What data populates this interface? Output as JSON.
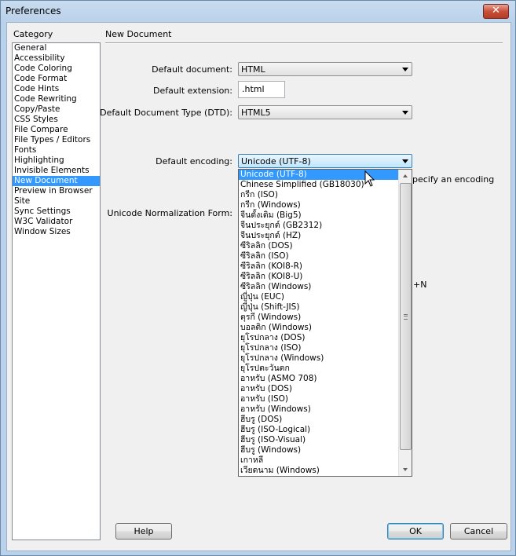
{
  "window": {
    "title": "Preferences",
    "close_glyph": "✕"
  },
  "category": {
    "label": "Category",
    "items": [
      "General",
      "Accessibility",
      "Code Coloring",
      "Code Format",
      "Code Hints",
      "Code Rewriting",
      "Copy/Paste",
      "CSS Styles",
      "File Compare",
      "File Types / Editors",
      "Fonts",
      "Highlighting",
      "Invisible Elements",
      "New Document",
      "Preview in Browser",
      "Site",
      "Sync Settings",
      "W3C Validator",
      "Window Sizes"
    ],
    "selected": "New Document"
  },
  "section": {
    "title": "New Document"
  },
  "form": {
    "default_document_label": "Default document:",
    "default_document_value": "HTML",
    "default_extension_label": "Default extension:",
    "default_extension_value": ".html",
    "dtd_label": "Default Document Type (DTD):",
    "dtd_value": "HTML5",
    "encoding_label": "Default encoding:",
    "encoding_value": "Unicode (UTF-8)",
    "encoding_partial_text": "pecify an encoding",
    "normalization_label": "Unicode Normalization Form:",
    "shortcut_partial_text": "+N"
  },
  "encoding_options": [
    "Unicode (UTF-8)",
    "Chinese Simplified (GB18030)",
    "กรีก (ISO)",
    "กรีก (Windows)",
    "จีนดั้งเดิม (Big5)",
    "จีนประยุกต์ (GB2312)",
    "จีนประยุกต์ (HZ)",
    "ซีริลลิก (DOS)",
    "ซีริลลิก (ISO)",
    "ซีริลลิก (KOI8-R)",
    "ซีริลลิก (KOI8-U)",
    "ซีริลลิก (Windows)",
    "ญี่ปุ่น (EUC)",
    "ญี่ปุ่น (Shift-JIS)",
    "ตุรกี (Windows)",
    "บอลติก (Windows)",
    "ยุโรปกลาง (DOS)",
    "ยุโรปกลาง (ISO)",
    "ยุโรปกลาง (Windows)",
    "ยุโรปตะวันตก",
    "อาหรับ (ASMO 708)",
    "อาหรับ (DOS)",
    "อาหรับ (ISO)",
    "อาหรับ (Windows)",
    "ฮีบรู (DOS)",
    "ฮีบรู (ISO-Logical)",
    "ฮีบรู (ISO-Visual)",
    "ฮีบรู (Windows)",
    "เกาหลี",
    "เวียดนาม (Windows)"
  ],
  "buttons": {
    "help": "Help",
    "ok": "OK",
    "cancel": "Cancel"
  },
  "colors": {
    "selection": "#3399ff",
    "close_button": "#c7503a"
  }
}
